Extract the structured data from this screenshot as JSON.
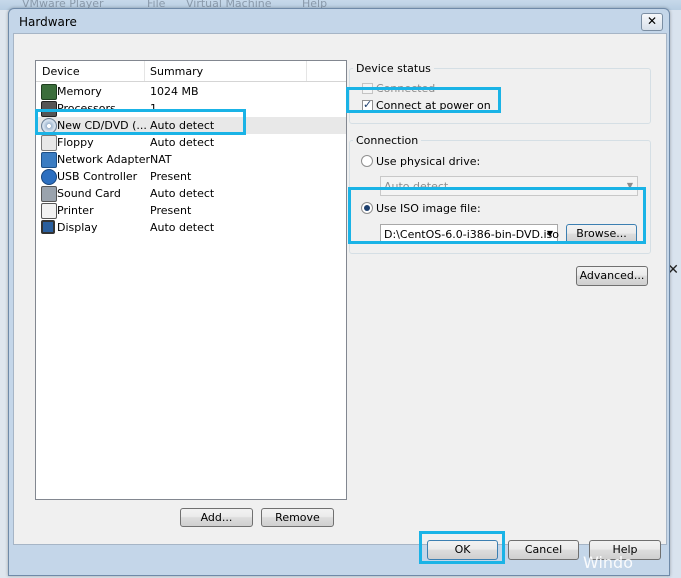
{
  "parent_menu": [
    "VMware Player",
    "File",
    "Virtual Machine",
    "Help"
  ],
  "dialog": {
    "title": "Hardware"
  },
  "device_list": {
    "headers": {
      "device": "Device",
      "summary": "Summary"
    },
    "rows": [
      {
        "device": "Memory",
        "summary": "1024 MB",
        "icon": "memory-icon"
      },
      {
        "device": "Processors",
        "summary": "1",
        "icon": "processor-icon"
      },
      {
        "device": "New CD/DVD (...",
        "summary": "Auto detect",
        "icon": "cd-dvd-icon"
      },
      {
        "device": "Floppy",
        "summary": "Auto detect",
        "icon": "floppy-icon"
      },
      {
        "device": "Network Adapter",
        "summary": "NAT",
        "icon": "network-adapter-icon"
      },
      {
        "device": "USB Controller",
        "summary": "Present",
        "icon": "usb-icon"
      },
      {
        "device": "Sound Card",
        "summary": "Auto detect",
        "icon": "sound-card-icon"
      },
      {
        "device": "Printer",
        "summary": "Present",
        "icon": "printer-icon"
      },
      {
        "device": "Display",
        "summary": "Auto detect",
        "icon": "display-icon"
      }
    ],
    "selected_index": 2
  },
  "buttons": {
    "add": "Add...",
    "remove": "Remove",
    "ok": "OK",
    "cancel": "Cancel",
    "help": "Help",
    "browse": "Browse...",
    "advanced": "Advanced..."
  },
  "device_status": {
    "title": "Device status",
    "connected_label": "Connected",
    "connected_checked": false,
    "connect_power_on_label": "Connect at power on",
    "connect_power_on_checked": true
  },
  "connection": {
    "title": "Connection",
    "physical_label": "Use physical drive:",
    "physical_value": "Auto detect",
    "iso_label": "Use ISO image file:",
    "iso_value": "D:\\CentOS-6.0-i386-bin-DVD.iso",
    "selected": "iso"
  },
  "watermark": "Windo",
  "colors": {
    "highlight": "#1ab3e6",
    "selection": "#e8e8e8"
  }
}
